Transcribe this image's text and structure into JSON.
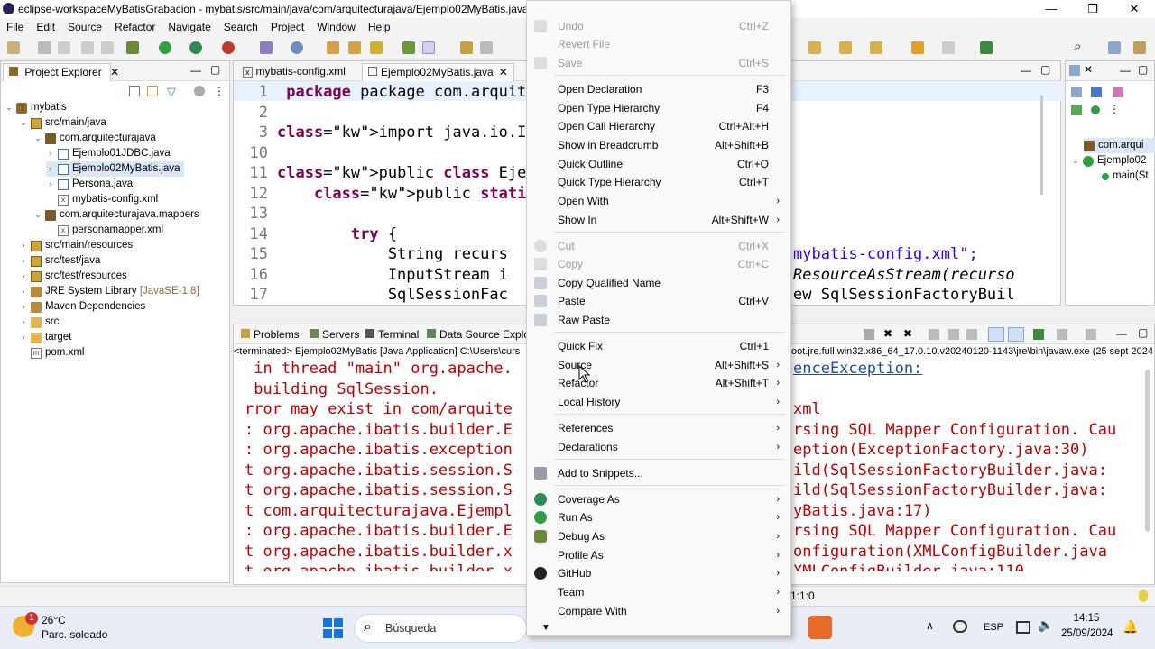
{
  "window": {
    "title": "eclipse-workspaceMyBatisGrabacion - mybatis/src/main/java/com/arquitecturajava/Ejemplo02MyBatis.java - Eclip",
    "minimize": "—",
    "maximize": "❐",
    "close": "✕"
  },
  "menubar": [
    "File",
    "Edit",
    "Source",
    "Refactor",
    "Navigate",
    "Search",
    "Project",
    "Window",
    "Help"
  ],
  "project_explorer": {
    "title": "Project Explorer",
    "tree": [
      {
        "label": "mybatis"
      },
      {
        "label": "src/main/java"
      },
      {
        "label": "com.arquitecturajava"
      },
      {
        "label": "Ejemplo01JDBC.java"
      },
      {
        "label": "Ejemplo02MyBatis.java"
      },
      {
        "label": "Persona.java"
      },
      {
        "label": "mybatis-config.xml"
      },
      {
        "label": "com.arquitecturajava.mappers"
      },
      {
        "label": "personamapper.xml"
      },
      {
        "label": "src/main/resources"
      },
      {
        "label": "src/test/java"
      },
      {
        "label": "src/test/resources"
      },
      {
        "label": "JRE System Library",
        "suffix": "[JavaSE-1.8]"
      },
      {
        "label": "Maven Dependencies"
      },
      {
        "label": "src"
      },
      {
        "label": "target"
      },
      {
        "label": "pom.xml"
      }
    ]
  },
  "editor": {
    "tabs": [
      "mybatis-config.xml",
      "Ejemplo02MyBatis.java"
    ],
    "lines": [
      {
        "n": "1",
        "text": "package com.arquitecturaj"
      },
      {
        "n": "2",
        "text": ""
      },
      {
        "n": "3",
        "text": "import java.io.IOExceptio"
      },
      {
        "n": "10",
        "text": ""
      },
      {
        "n": "11",
        "text": "public class Ejemplo02MyB"
      },
      {
        "n": "12",
        "text": "    public static void ma"
      },
      {
        "n": "13",
        "text": ""
      },
      {
        "n": "14",
        "text": "        try {"
      },
      {
        "n": "15",
        "text": "            String recurs"
      },
      {
        "n": "16",
        "text": "            InputStream i"
      },
      {
        "n": "17",
        "text": "            SqlSessionFac"
      }
    ],
    "right_fragments": [
      "mybatis-config.xml\";",
      "ResourceAsStream(recurso",
      "ew SqlSessionFactoryBuil"
    ]
  },
  "outline": {
    "items": [
      "com.arqui",
      "Ejemplo02",
      "main(St"
    ]
  },
  "bottom_tabs": [
    "Problems",
    "Servers",
    "Terminal",
    "Data Source Explor"
  ],
  "console": {
    "header": "<terminated> Ejemplo02MyBatis [Java Application] C:\\Users\\curs",
    "header_right": "oot.jre.full.win32.x86_64_17.0.10.v20240120-1143\\jre\\bin\\javaw.exe  (25 sept 2024 1",
    "left_lines": [
      " in thread \"main\" org.apache.",
      " building SqlSession.",
      "rror may exist in com/arquite",
      ": org.apache.ibatis.builder.E",
      ": org.apache.ibatis.exception",
      "t org.apache.ibatis.session.S",
      "t org.apache.ibatis.session.S",
      "t com.arquitecturajava.Ejempl",
      ": org.apache.ibatis.builder.E",
      "t org.apache.ibatis.builder.x",
      "t org.apache.ibatis.builder.x"
    ],
    "right_lines": [
      "enceException:",
      "",
      "xml",
      "rsing SQL Mapper Configuration. Cau",
      "eption(ExceptionFactory.java:30)",
      "ild(SqlSessionFactoryBuilder.java:",
      "ild(SqlSessionFactoryBuilder.java:",
      "yBatis.java:17)",
      "rsing SQL Mapper Configuration. Cau",
      "onfiguration(XMLConfigBuilder.java",
      "XMLConfigBuilder.java:110"
    ]
  },
  "status": {
    "position": "1:1:0"
  },
  "context_menu": {
    "items": [
      {
        "label": "Undo",
        "shortcut": "Ctrl+Z",
        "disabled": true
      },
      {
        "label": "Revert File",
        "shortcut": "",
        "disabled": true
      },
      {
        "label": "Save",
        "shortcut": "Ctrl+S",
        "disabled": true
      },
      {
        "label": "Open Declaration",
        "shortcut": "F3"
      },
      {
        "label": "Open Type Hierarchy",
        "shortcut": "F4"
      },
      {
        "label": "Open Call Hierarchy",
        "shortcut": "Ctrl+Alt+H"
      },
      {
        "label": "Show in Breadcrumb",
        "shortcut": "Alt+Shift+B"
      },
      {
        "label": "Quick Outline",
        "shortcut": "Ctrl+O"
      },
      {
        "label": "Quick Type Hierarchy",
        "shortcut": "Ctrl+T"
      },
      {
        "label": "Open With",
        "shortcut": "",
        "submenu": true
      },
      {
        "label": "Show In",
        "shortcut": "Alt+Shift+W",
        "submenu": true
      },
      {
        "label": "Cut",
        "shortcut": "Ctrl+X",
        "disabled": true
      },
      {
        "label": "Copy",
        "shortcut": "Ctrl+C",
        "disabled": true
      },
      {
        "label": "Copy Qualified Name",
        "shortcut": ""
      },
      {
        "label": "Paste",
        "shortcut": "Ctrl+V"
      },
      {
        "label": "Raw Paste",
        "shortcut": ""
      },
      {
        "label": "Quick Fix",
        "shortcut": "Ctrl+1"
      },
      {
        "label": "Source",
        "shortcut": "Alt+Shift+S",
        "submenu": true
      },
      {
        "label": "Refactor",
        "shortcut": "Alt+Shift+T",
        "submenu": true
      },
      {
        "label": "Local History",
        "shortcut": "",
        "submenu": true
      },
      {
        "label": "References",
        "shortcut": "",
        "submenu": true
      },
      {
        "label": "Declarations",
        "shortcut": "",
        "submenu": true
      },
      {
        "label": "Add to Snippets...",
        "shortcut": ""
      },
      {
        "label": "Coverage As",
        "shortcut": "",
        "submenu": true
      },
      {
        "label": "Run As",
        "shortcut": "",
        "submenu": true
      },
      {
        "label": "Debug As",
        "shortcut": "",
        "submenu": true
      },
      {
        "label": "Profile As",
        "shortcut": "",
        "submenu": true
      },
      {
        "label": "GitHub",
        "shortcut": "",
        "submenu": true
      },
      {
        "label": "Team",
        "shortcut": "",
        "submenu": true
      },
      {
        "label": "Compare With",
        "shortcut": "",
        "submenu": true
      }
    ]
  },
  "taskbar": {
    "weather_temp": "26°C",
    "weather_desc": "Parc. soleado",
    "badge": "1",
    "search_placeholder": "Búsqueda",
    "lang": "ESP",
    "time": "14:15",
    "date": "25/09/2024"
  }
}
